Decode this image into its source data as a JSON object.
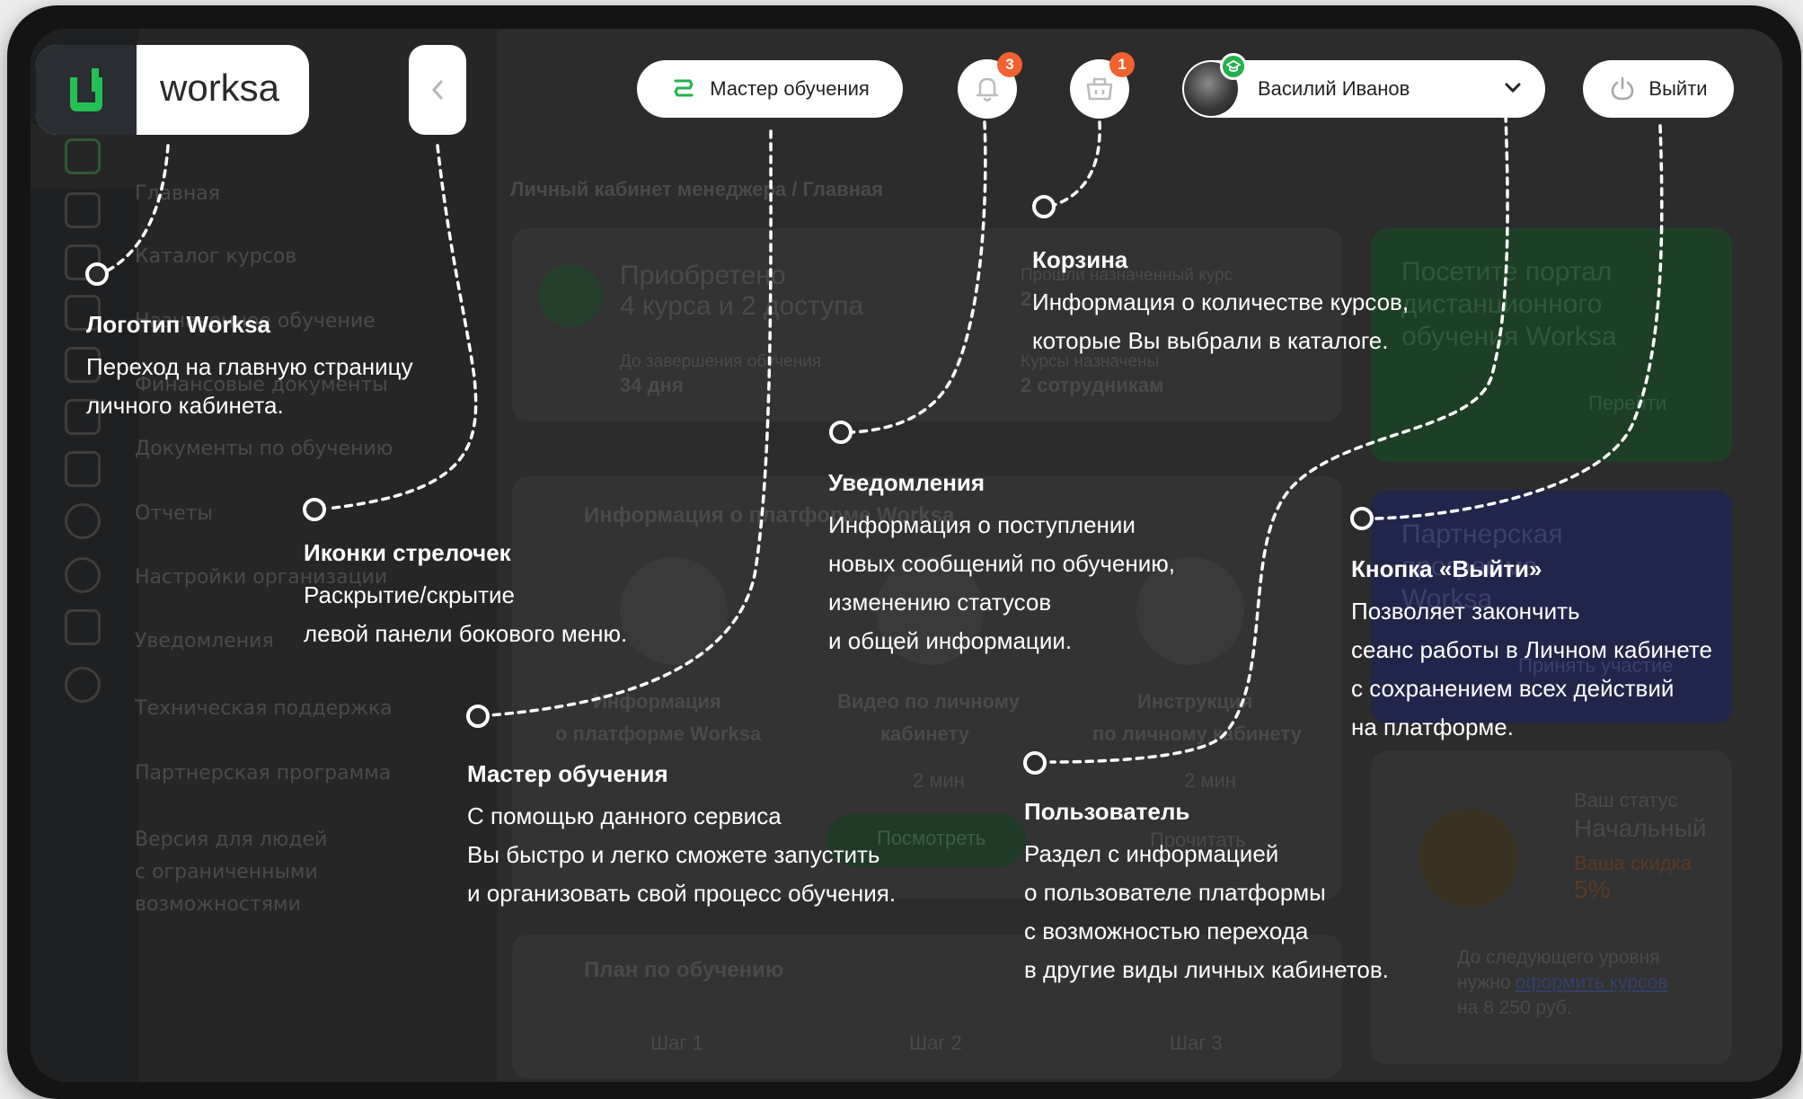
{
  "header": {
    "logo_text": "worksa",
    "master_label": "Мастер обучения",
    "notifications_badge": "3",
    "cart_badge": "1",
    "user_name": "Василий Иванов",
    "logout_label": "Выйти"
  },
  "background": {
    "breadcrumb": "Личный кабинет менеджера / Главная",
    "sidebar_items": [
      "Главная",
      "Каталог курсов",
      "Назначенное обучение",
      "Финансовые документы",
      "Документы по обучению",
      "Отчеты",
      "Настройки организации",
      "Уведомления",
      "Техническая поддержка",
      "Партнерская программа",
      "Версия для людей",
      "с ограниченными",
      "возможностями"
    ],
    "stat_title_1": "Приобретено",
    "stat_title_2": "4 курса и 2 доступа",
    "stat_label_1": "Прошли назначенный курс",
    "stat_value_1": "2",
    "stat_label_2": "До завершения обучения",
    "stat_value_2": "34 дня",
    "stat_label_3": "Курсы назначены",
    "stat_value_3": "2 сотрудникам",
    "info_section": "Информация о платформе Worksa",
    "video_1_a": "Информация",
    "video_1_b": "о платформе Worksa",
    "video_2_a": "Видео по личному",
    "video_2_b": "кабинету",
    "video_2_time": "2 мин",
    "video_3_a": "Инструкция",
    "video_3_b": "по личному кабинету",
    "video_3_time": "2 мин",
    "btn_view": "Посмотреть",
    "btn_read": "Прочитать",
    "promo_1_a": "Посетите портал",
    "promo_1_b": "дистанционного",
    "promo_1_c": "обучения Worksa",
    "promo_1_btn": "Перейти",
    "promo_2_a": "Партнерская",
    "promo_2_b": "программа",
    "promo_2_c": "Worksa",
    "promo_2_btn": "Принять участие",
    "status_label": "Ваш статус",
    "status_value": "Начальный",
    "discount_label": "Ваша скидка",
    "discount_value": "5%",
    "next_level_1": "До следующего уровня",
    "next_level_2": "нужно",
    "next_level_link": "оформить курсов",
    "next_level_3": "на 8 250 руб.",
    "plan_section": "План по обучению",
    "step_1": "Шаг 1",
    "step_2": "Шаг 2",
    "step_3": "Шаг 3"
  },
  "callouts": {
    "logo": {
      "title": "Логотип Worksa",
      "lines": [
        "Переход на главную страницу",
        "личного кабинета."
      ]
    },
    "arrows": {
      "title": "Иконки стрелочек",
      "lines": [
        "Раскрытие/скрытие",
        "левой панели бокового меню."
      ]
    },
    "master": {
      "title": "Мастер обучения",
      "lines": [
        "С помощью данного сервиса",
        "Вы быстро и легко сможете запустить",
        "и организовать свой процесс обучения."
      ]
    },
    "notifications": {
      "title": "Уведомления",
      "lines": [
        "Информация о поступлении",
        "новых сообщений по обучению,",
        "изменению статусов",
        "и общей информации."
      ]
    },
    "cart": {
      "title": "Корзина",
      "lines": [
        "Информация о количестве курсов,",
        "которые Вы выбрали в каталоге."
      ]
    },
    "user": {
      "title": "Пользователь",
      "lines": [
        "Раздел с информацией",
        "о пользователе платформы",
        "с возможностью перехода",
        "в другие виды личных кабинетов."
      ]
    },
    "logout": {
      "title": "Кнопка «Выйти»",
      "lines": [
        "Позволяет закончить",
        "сеанс работы в Личном кабинете",
        "с сохранением всех действий",
        "на платформе."
      ]
    }
  },
  "colors": {
    "accent_green": "#22b14c",
    "badge_orange": "#f2612f",
    "overlay": "#2c2c2c"
  }
}
